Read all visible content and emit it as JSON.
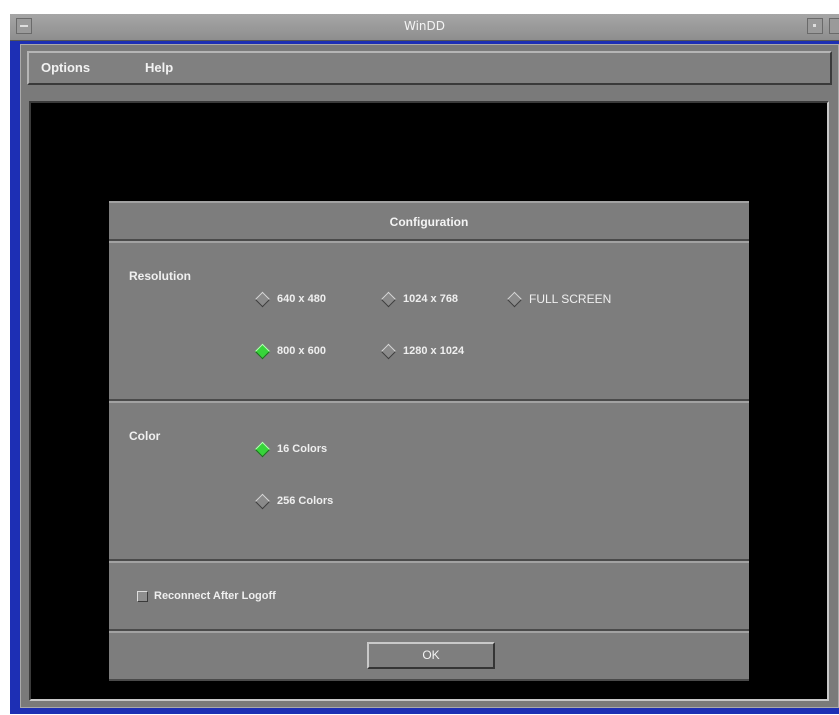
{
  "window": {
    "title": "WinDD"
  },
  "menubar": {
    "items": [
      "Options",
      "Help"
    ]
  },
  "dialog": {
    "title": "Configuration",
    "resolution": {
      "label": "Resolution",
      "options": [
        "640 x 480",
        "1024 x 768",
        "FULL SCREEN",
        "800 x 600",
        "1280 x 1024"
      ],
      "selected": "800 x 600"
    },
    "color": {
      "label": "Color",
      "options": [
        "16 Colors",
        "256 Colors"
      ],
      "selected": "16 Colors"
    },
    "reconnect": {
      "label": "Reconnect After Logoff",
      "checked": false
    },
    "ok_label": "OK"
  },
  "colors": {
    "selected_radio": "#37d43a",
    "window_border": "#1d2fb4",
    "panel": "#7d7d7d"
  }
}
